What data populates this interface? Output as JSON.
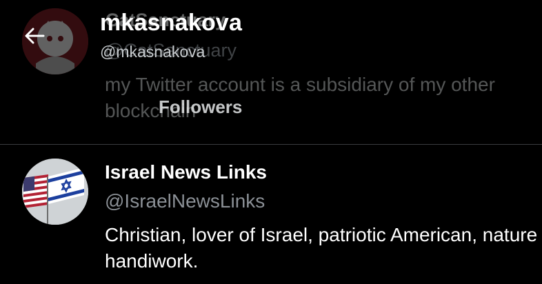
{
  "header": {
    "title": "mkasnakova",
    "handle": "@mkasnakova",
    "tab_label": "Followers"
  },
  "users": [
    {
      "name": "CatSanctuary",
      "handle": "@CatSanctuary",
      "bio": "my Twitter account is a subsidiary of my other blockchain"
    },
    {
      "name": "Israel News Links",
      "handle": "@IsraelNewsLinks",
      "bio": "Christian, lover of Israel, patriotic American, nature handiwork."
    }
  ],
  "icons": {
    "back": "arrow-left-icon"
  },
  "colors": {
    "background": "#000000",
    "primary_text": "#ffffff",
    "secondary_text": "#8b9096",
    "divider": "#3a3d40"
  }
}
